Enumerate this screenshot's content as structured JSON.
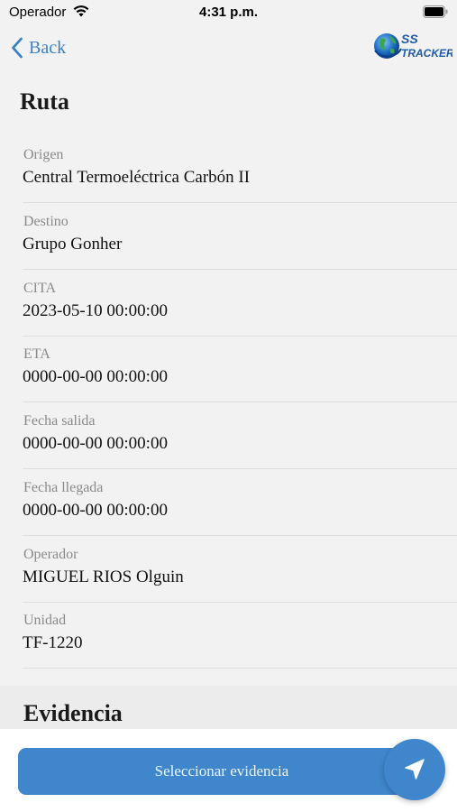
{
  "status_bar": {
    "carrier": "Operador",
    "time": "4:31 p.m.",
    "wifi_icon": "wifi-icon",
    "battery_icon": "battery-icon"
  },
  "nav": {
    "back_label": "Back",
    "back_icon": "chevron-left-icon",
    "logo_line1": "SS",
    "logo_line2": "TRACKER"
  },
  "route": {
    "title": "Ruta",
    "fields": [
      {
        "label": "Origen",
        "value": "Central Termoeléctrica Carbón II"
      },
      {
        "label": "Destino",
        "value": "Grupo Gonher"
      },
      {
        "label": "CITA",
        "value": "2023-05-10 00:00:00"
      },
      {
        "label": "ETA",
        "value": "0000-00-00 00:00:00"
      },
      {
        "label": "Fecha salida",
        "value": "0000-00-00 00:00:00"
      },
      {
        "label": "Fecha llegada",
        "value": "0000-00-00 00:00:00"
      },
      {
        "label": "Operador",
        "value": "MIGUEL RIOS Olguin"
      },
      {
        "label": "Unidad",
        "value": "TF-1220"
      }
    ]
  },
  "evidence": {
    "title": "Evidencia",
    "select_button_label": "Seleccionar evidencia",
    "fab_icon": "navigation-arrow-icon"
  },
  "colors": {
    "accent": "#3f86cc",
    "back_link": "#3b82c4",
    "background": "#f2f2f2",
    "label_gray": "#8a8a8a"
  }
}
